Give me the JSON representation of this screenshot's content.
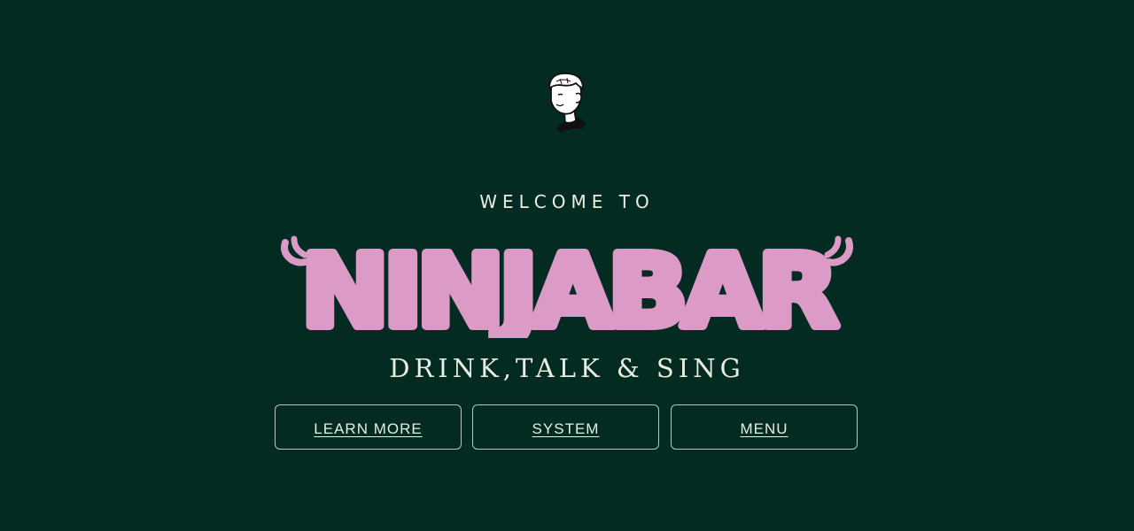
{
  "hero": {
    "welcome": "WELCOME TO",
    "brand_name": "NINJABAR",
    "tagline": "DRINK,TALK & SING"
  },
  "buttons": [
    {
      "label": "LEARN MORE"
    },
    {
      "label": "SYSTEM"
    },
    {
      "label": "MENU"
    }
  ],
  "colors": {
    "background": "#032b22",
    "brand_pink": "#dc9bc6",
    "text": "#e9eee0",
    "button_border": "#b9c7bf"
  },
  "icons": {
    "logo": "ninja-mascot-head-icon"
  }
}
